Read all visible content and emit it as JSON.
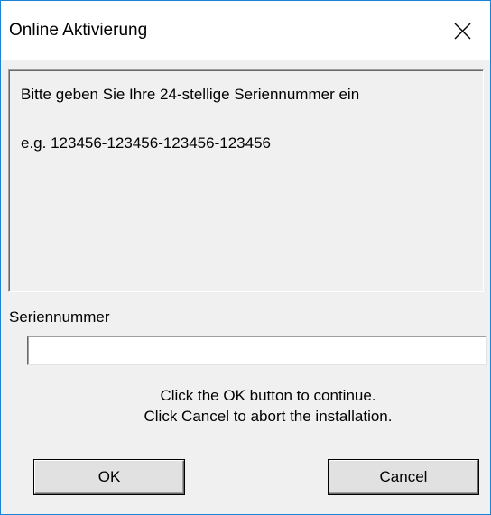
{
  "window": {
    "title": "Online Aktivierung",
    "close_label": "Close"
  },
  "info": {
    "line1": "Bitte geben Sie Ihre 24-stellige Seriennummer ein",
    "line2": "e.g. 123456-123456-123456-123456"
  },
  "serial": {
    "label": "Seriennummer",
    "value": "",
    "placeholder": ""
  },
  "hints": {
    "line1": "Click the OK button to continue.",
    "line2": "Click Cancel to abort the installation."
  },
  "buttons": {
    "ok_label": "OK",
    "cancel_label": "Cancel"
  },
  "colors": {
    "border_accent": "#1883d7",
    "dialog_background": "#f0f0f0",
    "button_face": "#e1e1e1"
  },
  "icons": {
    "close": "close-icon"
  }
}
